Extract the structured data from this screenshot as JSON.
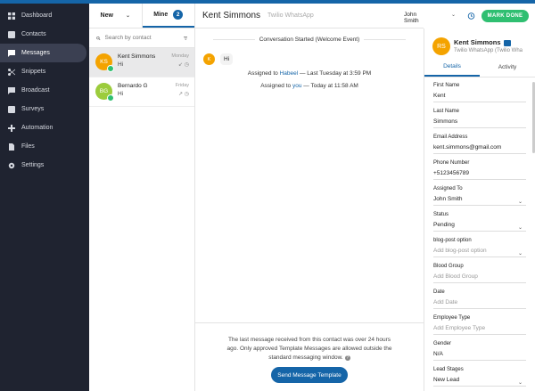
{
  "sidebar": {
    "items": [
      {
        "label": "Dashboard",
        "icon": "dashboard-icon"
      },
      {
        "label": "Contacts",
        "icon": "contacts-icon"
      },
      {
        "label": "Messages",
        "icon": "messages-icon"
      },
      {
        "label": "Snippets",
        "icon": "scissors-icon"
      },
      {
        "label": "Broadcast",
        "icon": "broadcast-icon"
      },
      {
        "label": "Surveys",
        "icon": "surveys-icon"
      },
      {
        "label": "Automation",
        "icon": "automation-icon"
      },
      {
        "label": "Files",
        "icon": "file-icon"
      },
      {
        "label": "Settings",
        "icon": "gear-icon"
      }
    ]
  },
  "convlist": {
    "tab_new": "New",
    "tab_mine": "Mine",
    "mine_count": "2",
    "search_placeholder": "Search by contact",
    "items": [
      {
        "initials": "KS",
        "name": "Kent Simmons",
        "message": "Hi",
        "time": "Monday",
        "avatar_color": "#f4a300"
      },
      {
        "initials": "BG",
        "name": "Bernardo G",
        "message": "Hi",
        "time": "Friday",
        "avatar_color": "#9ccc3c"
      }
    ]
  },
  "chat": {
    "title": "Kent Simmons",
    "channel": "Twilio WhatsApp",
    "assignee": "John Smith",
    "started": "Conversation Started (Welcome Event)",
    "msg_initial": "K",
    "msg_text": "Hi",
    "assign1_pre": "Assigned to",
    "assign1_name": "Habeel",
    "assign1_post": "— Last Tuesday at 3:59 PM",
    "assign2_pre": "Assigned to",
    "assign2_name": "you",
    "assign2_post": "— Today at 11:58 AM",
    "footer_note": "The last message received from this contact was over 24 hours ago. Only approved Template Messages are allowed outside the standard messaging window.",
    "send_template": "Send Message Template",
    "mark_done": "MARK DONE"
  },
  "contact": {
    "initials": "RS",
    "name": "Kent Simmons",
    "channel": "Twilio WhatsApp (Twilio Wha",
    "tab_details": "Details",
    "tab_activity": "Activity",
    "fields": [
      {
        "label": "First Name",
        "value": "Kent"
      },
      {
        "label": "Last Name",
        "value": "Simmons"
      },
      {
        "label": "Email Address",
        "value": "kent.simmons@gmail.com"
      },
      {
        "label": "Phone Number",
        "value": "+5123456789"
      },
      {
        "label": "Assigned To",
        "value": "John Smith"
      },
      {
        "label": "Status",
        "value": "Pending"
      },
      {
        "label": "blog-post option",
        "placeholder": "Add blog-post option"
      },
      {
        "label": "Blood Group",
        "placeholder": "Add Blood Group"
      },
      {
        "label": "Date",
        "placeholder": "Add Date"
      },
      {
        "label": "Employee Type",
        "placeholder": "Add Employee Type"
      },
      {
        "label": "Gender",
        "value": "N/A"
      },
      {
        "label": "Lead Stages",
        "value": "New Lead"
      }
    ]
  },
  "colors": {
    "brand": "#1565a8",
    "sidebar": "#1f2330",
    "success": "#2fbf71"
  }
}
